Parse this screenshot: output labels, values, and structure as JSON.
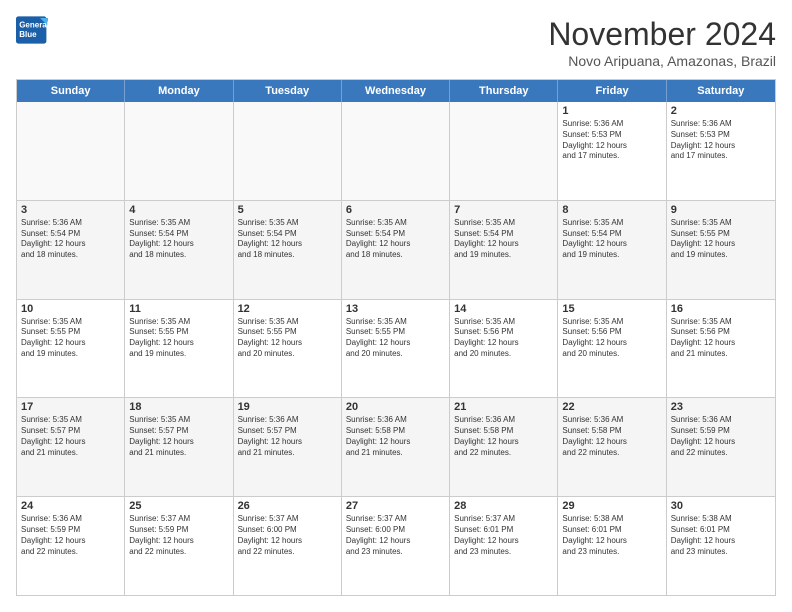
{
  "logo": {
    "line1": "General",
    "line2": "Blue"
  },
  "title": "November 2024",
  "location": "Novo Aripuana, Amazonas, Brazil",
  "days": [
    "Sunday",
    "Monday",
    "Tuesday",
    "Wednesday",
    "Thursday",
    "Friday",
    "Saturday"
  ],
  "weeks": [
    [
      {
        "day": "",
        "info": ""
      },
      {
        "day": "",
        "info": ""
      },
      {
        "day": "",
        "info": ""
      },
      {
        "day": "",
        "info": ""
      },
      {
        "day": "",
        "info": ""
      },
      {
        "day": "1",
        "info": "Sunrise: 5:36 AM\nSunset: 5:53 PM\nDaylight: 12 hours\nand 17 minutes."
      },
      {
        "day": "2",
        "info": "Sunrise: 5:36 AM\nSunset: 5:53 PM\nDaylight: 12 hours\nand 17 minutes."
      }
    ],
    [
      {
        "day": "3",
        "info": "Sunrise: 5:36 AM\nSunset: 5:54 PM\nDaylight: 12 hours\nand 18 minutes."
      },
      {
        "day": "4",
        "info": "Sunrise: 5:35 AM\nSunset: 5:54 PM\nDaylight: 12 hours\nand 18 minutes."
      },
      {
        "day": "5",
        "info": "Sunrise: 5:35 AM\nSunset: 5:54 PM\nDaylight: 12 hours\nand 18 minutes."
      },
      {
        "day": "6",
        "info": "Sunrise: 5:35 AM\nSunset: 5:54 PM\nDaylight: 12 hours\nand 18 minutes."
      },
      {
        "day": "7",
        "info": "Sunrise: 5:35 AM\nSunset: 5:54 PM\nDaylight: 12 hours\nand 19 minutes."
      },
      {
        "day": "8",
        "info": "Sunrise: 5:35 AM\nSunset: 5:54 PM\nDaylight: 12 hours\nand 19 minutes."
      },
      {
        "day": "9",
        "info": "Sunrise: 5:35 AM\nSunset: 5:55 PM\nDaylight: 12 hours\nand 19 minutes."
      }
    ],
    [
      {
        "day": "10",
        "info": "Sunrise: 5:35 AM\nSunset: 5:55 PM\nDaylight: 12 hours\nand 19 minutes."
      },
      {
        "day": "11",
        "info": "Sunrise: 5:35 AM\nSunset: 5:55 PM\nDaylight: 12 hours\nand 19 minutes."
      },
      {
        "day": "12",
        "info": "Sunrise: 5:35 AM\nSunset: 5:55 PM\nDaylight: 12 hours\nand 20 minutes."
      },
      {
        "day": "13",
        "info": "Sunrise: 5:35 AM\nSunset: 5:55 PM\nDaylight: 12 hours\nand 20 minutes."
      },
      {
        "day": "14",
        "info": "Sunrise: 5:35 AM\nSunset: 5:56 PM\nDaylight: 12 hours\nand 20 minutes."
      },
      {
        "day": "15",
        "info": "Sunrise: 5:35 AM\nSunset: 5:56 PM\nDaylight: 12 hours\nand 20 minutes."
      },
      {
        "day": "16",
        "info": "Sunrise: 5:35 AM\nSunset: 5:56 PM\nDaylight: 12 hours\nand 21 minutes."
      }
    ],
    [
      {
        "day": "17",
        "info": "Sunrise: 5:35 AM\nSunset: 5:57 PM\nDaylight: 12 hours\nand 21 minutes."
      },
      {
        "day": "18",
        "info": "Sunrise: 5:35 AM\nSunset: 5:57 PM\nDaylight: 12 hours\nand 21 minutes."
      },
      {
        "day": "19",
        "info": "Sunrise: 5:36 AM\nSunset: 5:57 PM\nDaylight: 12 hours\nand 21 minutes."
      },
      {
        "day": "20",
        "info": "Sunrise: 5:36 AM\nSunset: 5:58 PM\nDaylight: 12 hours\nand 21 minutes."
      },
      {
        "day": "21",
        "info": "Sunrise: 5:36 AM\nSunset: 5:58 PM\nDaylight: 12 hours\nand 22 minutes."
      },
      {
        "day": "22",
        "info": "Sunrise: 5:36 AM\nSunset: 5:58 PM\nDaylight: 12 hours\nand 22 minutes."
      },
      {
        "day": "23",
        "info": "Sunrise: 5:36 AM\nSunset: 5:59 PM\nDaylight: 12 hours\nand 22 minutes."
      }
    ],
    [
      {
        "day": "24",
        "info": "Sunrise: 5:36 AM\nSunset: 5:59 PM\nDaylight: 12 hours\nand 22 minutes."
      },
      {
        "day": "25",
        "info": "Sunrise: 5:37 AM\nSunset: 5:59 PM\nDaylight: 12 hours\nand 22 minutes."
      },
      {
        "day": "26",
        "info": "Sunrise: 5:37 AM\nSunset: 6:00 PM\nDaylight: 12 hours\nand 22 minutes."
      },
      {
        "day": "27",
        "info": "Sunrise: 5:37 AM\nSunset: 6:00 PM\nDaylight: 12 hours\nand 23 minutes."
      },
      {
        "day": "28",
        "info": "Sunrise: 5:37 AM\nSunset: 6:01 PM\nDaylight: 12 hours\nand 23 minutes."
      },
      {
        "day": "29",
        "info": "Sunrise: 5:38 AM\nSunset: 6:01 PM\nDaylight: 12 hours\nand 23 minutes."
      },
      {
        "day": "30",
        "info": "Sunrise: 5:38 AM\nSunset: 6:01 PM\nDaylight: 12 hours\nand 23 minutes."
      }
    ]
  ]
}
